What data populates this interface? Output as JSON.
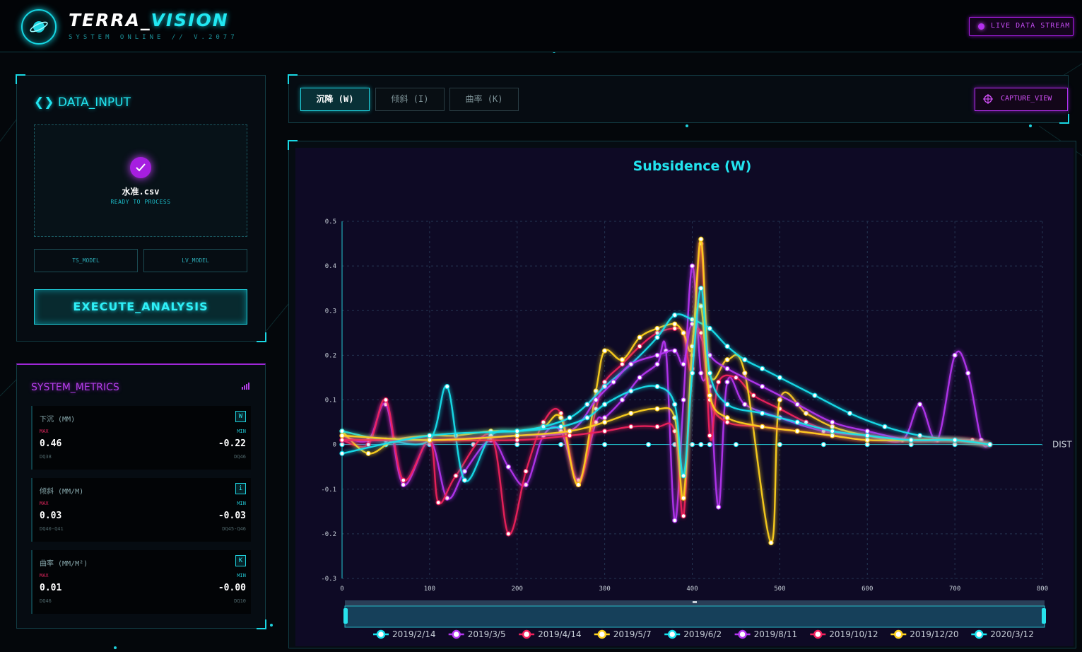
{
  "app": {
    "brand_main": "TERRA_",
    "brand_accent": "VISION",
    "subtitle": "SYSTEM ONLINE // V.2077",
    "live_label": "LIVE DATA STREAM"
  },
  "input_panel": {
    "title": "DATA_INPUT",
    "file_name": "水准.csv",
    "file_status": "READY TO PROCESS",
    "model_a": "TS_MODEL",
    "model_b": "LV_MODEL",
    "execute_label": "EXECUTE_ANALYSIS"
  },
  "metrics_panel": {
    "title": "SYSTEM_METRICS",
    "max_label": "MAX",
    "min_label": "MIN",
    "items": [
      {
        "name": "下沉 (MM)",
        "key": "W",
        "max": "0.46",
        "max_point": "DQ38",
        "min": "-0.22",
        "min_point": "DQ46"
      },
      {
        "name": "倾斜 (MM/M)",
        "key": "i",
        "max": "0.03",
        "max_point": "DQ40-Q41",
        "min": "-0.03",
        "min_point": "DQ45-Q46"
      },
      {
        "name": "曲率 (MM/M²)",
        "key": "K",
        "max": "0.01",
        "max_point": "DQ46",
        "min": "-0.00",
        "min_point": "DQ10"
      }
    ]
  },
  "tabs": [
    {
      "label": "沉降 (W)",
      "active": true
    },
    {
      "label": "倾斜 (I)",
      "active": false
    },
    {
      "label": "曲率 (K)",
      "active": false
    }
  ],
  "capture_label": "CAPTURE_VIEW",
  "colors": {
    "cyan": "#19e3ef",
    "purple": "#b536f2",
    "red": "#f0205c",
    "yellow": "#ffd21f"
  },
  "chart_data": {
    "type": "line",
    "title": "Subsidence (W)",
    "xlabel": "DIST",
    "ylabel": "",
    "xlim": [
      0,
      800
    ],
    "ylim": [
      -0.3,
      0.5
    ],
    "xticks": [
      0,
      100,
      200,
      300,
      400,
      500,
      600,
      700,
      800
    ],
    "yticks": [
      -0.3,
      -0.2,
      -0.1,
      0,
      0.1,
      0.2,
      0.3,
      0.4,
      0.5
    ],
    "grid": true,
    "legend_position": "bottom",
    "series": [
      {
        "name": "2019/2/14",
        "color": "#19e3ef",
        "x": [
          0,
          50,
          100,
          150,
          200,
          250,
          300,
          350,
          380,
          400,
          410,
          420,
          450,
          500,
          550,
          600,
          650,
          700,
          740
        ],
        "y": [
          0,
          0,
          0,
          0,
          0,
          0,
          0,
          0,
          0,
          0,
          0,
          0,
          0,
          0,
          0,
          0,
          0,
          0,
          0
        ]
      },
      {
        "name": "2019/3/5",
        "color": "#b536f2",
        "x": [
          0,
          30,
          50,
          70,
          100,
          120,
          140,
          170,
          190,
          210,
          230,
          250,
          270,
          290,
          300,
          320,
          340,
          360,
          370,
          380,
          390,
          400,
          410,
          420,
          430,
          440,
          460,
          500,
          550,
          600,
          640,
          660,
          680,
          700,
          715,
          730,
          740
        ],
        "y": [
          0.02,
          0.01,
          0.09,
          -0.09,
          0.01,
          -0.12,
          -0.06,
          0.01,
          -0.05,
          -0.09,
          0.02,
          0.03,
          -0.08,
          0.05,
          0.06,
          0.1,
          0.15,
          0.18,
          0.21,
          -0.17,
          0.1,
          0.4,
          0.16,
          0.13,
          -0.14,
          0.14,
          0.09,
          0.06,
          0.03,
          0.02,
          0.01,
          0.09,
          0.01,
          0.2,
          0.16,
          0.01,
          0
        ]
      },
      {
        "name": "2019/4/14",
        "color": "#f0205c",
        "x": [
          0,
          30,
          50,
          70,
          100,
          110,
          130,
          170,
          190,
          210,
          230,
          250,
          270,
          290,
          300,
          320,
          340,
          360,
          380,
          390,
          400,
          410,
          420,
          430,
          450,
          470,
          500,
          530,
          560,
          600,
          640,
          680,
          700,
          720,
          740
        ],
        "y": [
          0.01,
          0,
          0.1,
          -0.08,
          0.01,
          -0.13,
          -0.07,
          0.02,
          -0.2,
          -0.06,
          0.05,
          0.07,
          -0.09,
          0.08,
          0.14,
          0.18,
          0.22,
          0.25,
          0.26,
          0.25,
          0.17,
          0.45,
          0.02,
          0.14,
          0.15,
          0.11,
          0.08,
          0.05,
          0.03,
          0.02,
          0.01,
          0.01,
          0.01,
          0.01,
          0
        ]
      },
      {
        "name": "2019/5/7",
        "color": "#ffd21f",
        "x": [
          0,
          30,
          60,
          100,
          130,
          170,
          200,
          230,
          250,
          270,
          290,
          300,
          320,
          340,
          360,
          380,
          390,
          400,
          410,
          420,
          440,
          460,
          490,
          500,
          530,
          560,
          600,
          650,
          700,
          740
        ],
        "y": [
          0.03,
          -0.02,
          0.01,
          0.02,
          0.02,
          0.03,
          0.03,
          0.04,
          0.06,
          -0.09,
          0.12,
          0.21,
          0.19,
          0.24,
          0.26,
          0.27,
          0.25,
          0.22,
          0.46,
          0.16,
          0.19,
          0.16,
          -0.22,
          0.1,
          0.07,
          0.04,
          0.02,
          0.01,
          0.01,
          0
        ]
      },
      {
        "name": "2019/6/2",
        "color": "#19e3ef",
        "x": [
          0,
          50,
          100,
          120,
          140,
          170,
          200,
          230,
          260,
          280,
          300,
          330,
          360,
          380,
          400,
          420,
          440,
          460,
          480,
          500,
          540,
          580,
          620,
          660,
          700,
          740
        ],
        "y": [
          0.03,
          0.01,
          0.01,
          0.13,
          -0.08,
          0.02,
          0.03,
          0.04,
          0.06,
          0.09,
          0.13,
          0.18,
          0.24,
          0.29,
          0.28,
          0.26,
          0.22,
          0.19,
          0.17,
          0.15,
          0.11,
          0.07,
          0.04,
          0.02,
          0.01,
          0
        ]
      },
      {
        "name": "2019/8/11",
        "color": "#b536f2",
        "x": [
          0,
          100,
          200,
          260,
          290,
          310,
          330,
          360,
          380,
          390,
          400,
          420,
          440,
          480,
          520,
          560,
          600,
          650,
          700,
          740
        ],
        "y": [
          0.01,
          0.01,
          0.02,
          0.03,
          0.1,
          0.14,
          0.18,
          0.2,
          0.21,
          0.18,
          0.27,
          0.2,
          0.17,
          0.13,
          0.09,
          0.05,
          0.03,
          0.01,
          0.01,
          0
        ]
      },
      {
        "name": "2019/10/12",
        "color": "#f0205c",
        "x": [
          0,
          100,
          200,
          260,
          300,
          330,
          360,
          380,
          390,
          400,
          410,
          420,
          440,
          480,
          520,
          560,
          600,
          650,
          700,
          740
        ],
        "y": [
          0.01,
          0.01,
          0.01,
          0.02,
          0.03,
          0.04,
          0.04,
          0.03,
          -0.16,
          0.2,
          0.25,
          0.1,
          0.05,
          0.04,
          0.03,
          0.02,
          0.01,
          0.01,
          0.01,
          0
        ]
      },
      {
        "name": "2019/12/20",
        "color": "#ffd21f",
        "x": [
          0,
          100,
          200,
          260,
          300,
          330,
          360,
          380,
          390,
          400,
          410,
          420,
          440,
          480,
          520,
          560,
          600,
          650,
          700,
          740
        ],
        "y": [
          0.02,
          0.01,
          0.02,
          0.03,
          0.05,
          0.07,
          0.08,
          0.06,
          -0.12,
          0.22,
          0.31,
          0.11,
          0.06,
          0.04,
          0.03,
          0.02,
          0.01,
          0.01,
          0.01,
          0
        ]
      },
      {
        "name": "2020/3/12",
        "color": "#19e3ef",
        "x": [
          0,
          100,
          200,
          250,
          280,
          300,
          330,
          360,
          380,
          390,
          400,
          410,
          420,
          440,
          480,
          520,
          560,
          600,
          650,
          700,
          740
        ],
        "y": [
          -0.02,
          0.02,
          0.03,
          0.04,
          0.06,
          0.09,
          0.12,
          0.13,
          0.09,
          -0.07,
          0.16,
          0.35,
          0.16,
          0.09,
          0.07,
          0.05,
          0.03,
          0.02,
          0.01,
          0.01,
          0
        ]
      }
    ]
  }
}
